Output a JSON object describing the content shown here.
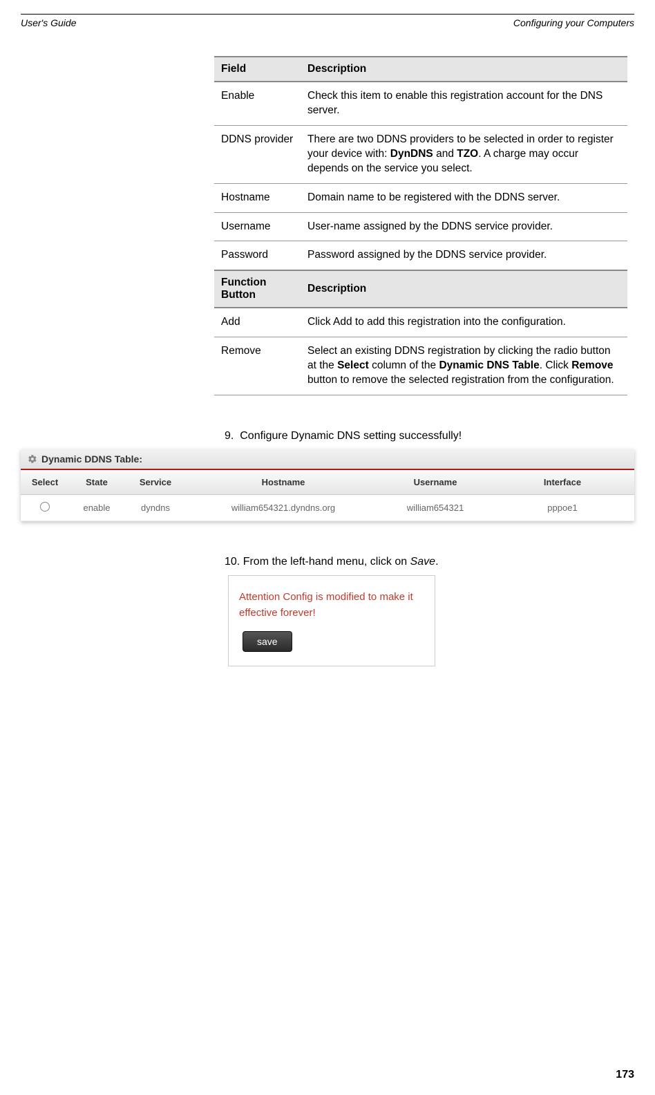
{
  "header": {
    "left": "User's Guide",
    "right": "Configuring your Computers"
  },
  "table1": {
    "headers": [
      "Field",
      "Description"
    ],
    "rows": [
      {
        "field": "Enable",
        "desc": "Check this item to enable this registration account for the DNS server."
      },
      {
        "field": "DDNS provider",
        "desc_parts": [
          "There are two DDNS providers to be selected in order to register your device with: ",
          "DynDNS",
          " and ",
          "TZO",
          ". A charge may occur depends on the service you select."
        ]
      },
      {
        "field": "Hostname",
        "desc": "Domain name to be registered with the DDNS server."
      },
      {
        "field": "Username",
        "desc": "User-name assigned by the DDNS service provider."
      },
      {
        "field": "Password",
        "desc": "Password assigned by the DDNS service provider."
      }
    ]
  },
  "table2": {
    "headers": [
      "Function Button",
      "Description"
    ],
    "rows": [
      {
        "field": "Add",
        "desc": "Click Add to add this registration into the configuration."
      },
      {
        "field": "Remove",
        "desc_parts": [
          "Select an existing DDNS registration by clicking the radio button at the ",
          "Select",
          " column of the ",
          "Dynamic DNS Table",
          ". Click ",
          "Remove",
          " button to remove the selected registration from the configuration."
        ]
      }
    ]
  },
  "step9": {
    "num": "9.",
    "text": "Configure Dynamic DNS setting successfully!"
  },
  "ddns_figure": {
    "title": "Dynamic DDNS Table:",
    "headers": [
      "Select",
      "State",
      "Service",
      "Hostname",
      "Username",
      "Interface"
    ],
    "row": {
      "state": "enable",
      "service": "dyndns",
      "hostname": "william654321.dyndns.org",
      "username": "william654321",
      "interface": "pppoe1"
    }
  },
  "step10": {
    "num": "10.",
    "text_parts": [
      "From the left-hand menu, click on ",
      "Save",
      "."
    ]
  },
  "save_figure": {
    "attention": "Attention Config is modified to make it effective forever!",
    "button": "save"
  },
  "page_number": "173"
}
